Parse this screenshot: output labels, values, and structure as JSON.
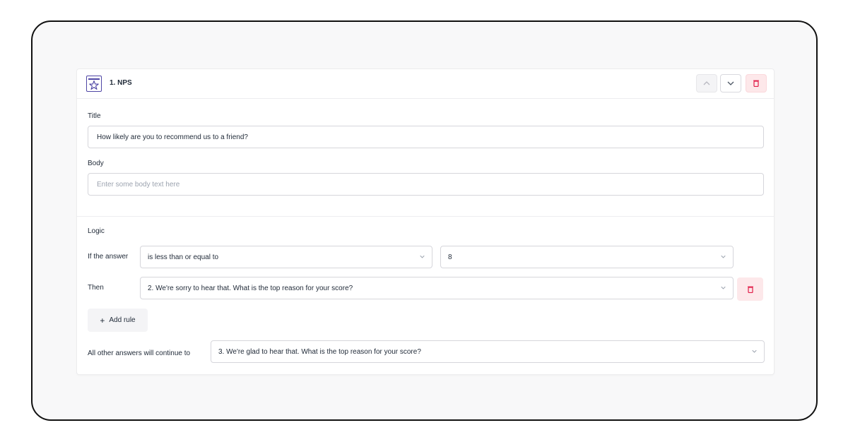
{
  "question": {
    "title": "1. NPS",
    "icon": "star-icon",
    "accent_color": "#4f46a5",
    "danger_color": "#e11d48"
  },
  "fields": {
    "title_label": "Title",
    "title_value": "How likely are you to recommend us to a friend?",
    "body_label": "Body",
    "body_placeholder": "Enter some body text here"
  },
  "logic": {
    "label": "Logic",
    "if_label": "If the answer",
    "condition": "is less than or equal to",
    "value": "8",
    "then_label": "Then",
    "then_target": "2. We're sorry to hear that. What is the top reason for your score?",
    "add_rule_icon": "+",
    "add_rule_label": "Add rule",
    "other_label": "All other answers will continue to",
    "other_target": "3. We're glad to hear that. What is the top reason for your score?"
  }
}
